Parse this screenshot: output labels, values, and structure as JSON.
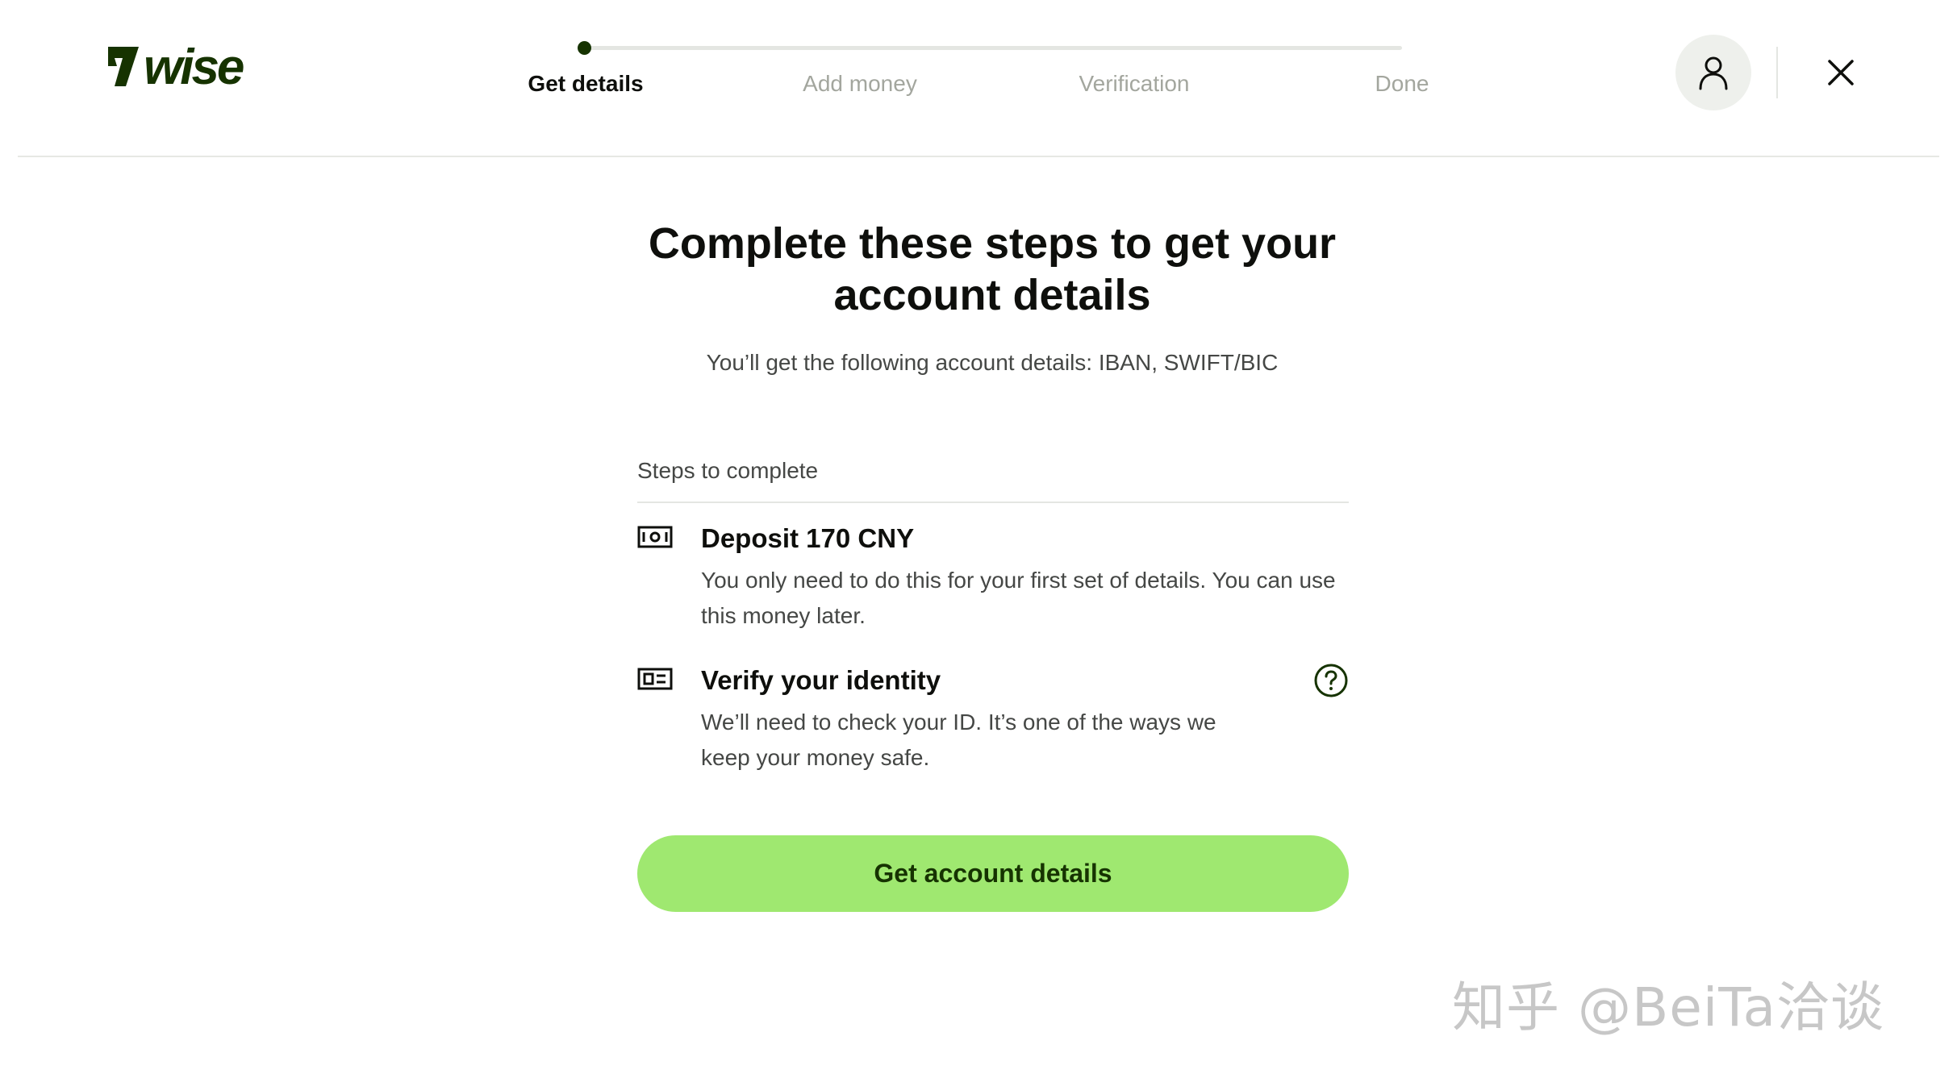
{
  "brand": {
    "name": "wise",
    "color": "#163300"
  },
  "stepper": {
    "steps": [
      {
        "label": "Get details",
        "active": true
      },
      {
        "label": "Add money",
        "active": false
      },
      {
        "label": "Verification",
        "active": false
      },
      {
        "label": "Done",
        "active": false
      }
    ]
  },
  "header": {
    "profile_icon": "user-icon",
    "close_icon": "close-icon"
  },
  "main": {
    "title": "Complete these steps to get your account details",
    "subtitle": "You’ll get the following account details: IBAN, SWIFT/BIC",
    "steps_heading": "Steps to complete",
    "steps": [
      {
        "icon": "banknote-icon",
        "title": "Deposit 170 CNY",
        "description": "You only need to do this for your first set of details. You can use this money later."
      },
      {
        "icon": "id-card-icon",
        "title": "Verify your identity",
        "description": "We’ll need to check your ID. It’s one of the ways we keep your money safe.",
        "help_icon": "question-circle-icon"
      }
    ],
    "cta_label": "Get account details"
  },
  "watermark": "知乎 @BeiTa洽谈",
  "colors": {
    "accent": "#9fe870",
    "forest": "#163300",
    "muted_text": "#a3a69e",
    "body_text": "#454745"
  }
}
